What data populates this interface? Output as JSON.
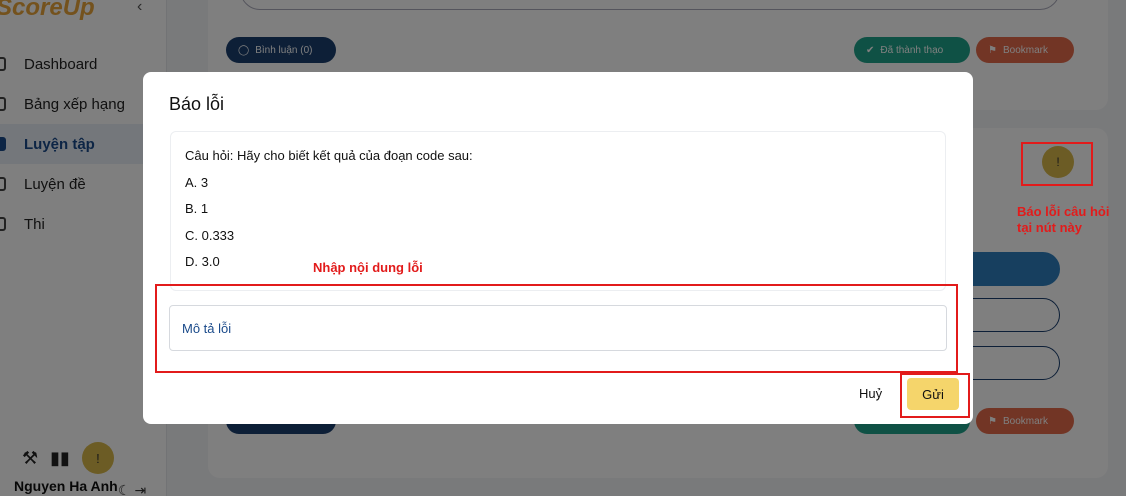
{
  "app": {
    "logo": "ScoreUp",
    "collapse_icon": "chevron-left-icon"
  },
  "sidebar": {
    "items": [
      {
        "label": "Dashboard",
        "active": false
      },
      {
        "label": "Bảng xếp hạng",
        "active": false
      },
      {
        "label": "Luyện tập",
        "active": true
      },
      {
        "label": "Luyện đề",
        "active": false
      },
      {
        "label": "Thi",
        "active": false
      }
    ],
    "user_name": "Nguyen Ha Anh"
  },
  "background": {
    "comment_label": "Bình luận (0)",
    "done_label": "Đã thành thạo",
    "bookmark_label": "Bookmark"
  },
  "modal": {
    "title": "Báo lỗi",
    "question": "Câu hỏi: Hãy cho biết kết quả của đoạn code sau:",
    "options": [
      "A. 3",
      "B. 1",
      "C. 0.333",
      "D. 3.0"
    ],
    "description_placeholder": "Mô tả lỗi",
    "cancel_label": "Huỷ",
    "send_label": "Gửi"
  },
  "annotations": {
    "input_note": "Nhập nội dung lỗi",
    "report_note_line1": "Báo lỗi câu hỏi",
    "report_note_line2": "tại nút này",
    "color": "#e21b1b"
  },
  "colors": {
    "accent": "#f5d56b",
    "brand": "#1a3e6e",
    "success": "#1fa38a",
    "bookmark": "#e46a4b"
  }
}
